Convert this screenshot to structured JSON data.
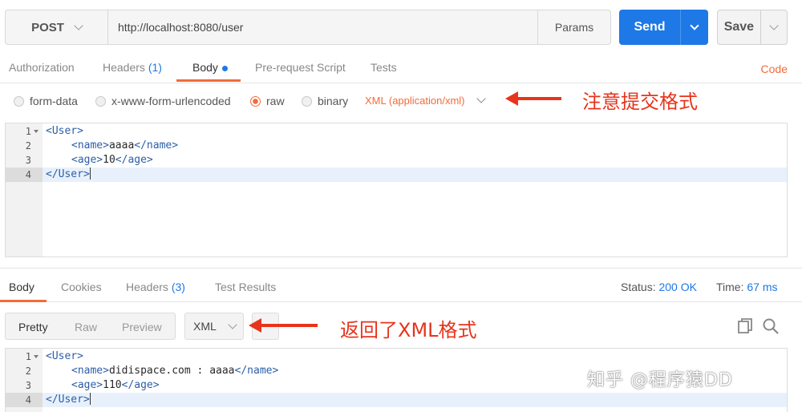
{
  "request": {
    "method": "POST",
    "url": "http://localhost:8080/user",
    "params_label": "Params",
    "send_label": "Send",
    "save_label": "Save"
  },
  "request_tabs": {
    "authorization": "Authorization",
    "headers": "Headers",
    "headers_count": "(1)",
    "body": "Body",
    "prerequest": "Pre-request Script",
    "tests": "Tests",
    "code": "Code"
  },
  "body_types": {
    "form_data": "form-data",
    "urlencoded": "x-www-form-urlencoded",
    "raw": "raw",
    "binary": "binary",
    "selected": "raw",
    "content_type": "XML (application/xml)"
  },
  "request_editor": {
    "line_numbers": [
      "1",
      "2",
      "3",
      "4"
    ],
    "line1_tag": "<User>",
    "line2_open": "<name>",
    "line2_text": "aaaa",
    "line2_close": "</name>",
    "line3_open": "<age>",
    "line3_text": "10",
    "line3_close": "</age>",
    "line4_tag": "</User>"
  },
  "annotations": {
    "note_request": "注意提交格式",
    "note_response": "返回了XML格式"
  },
  "response_tabs": {
    "body": "Body",
    "cookies": "Cookies",
    "headers": "Headers",
    "headers_count": "(3)",
    "test_results": "Test Results"
  },
  "response_status": {
    "status_label": "Status:",
    "status_value": "200 OK",
    "time_label": "Time:",
    "time_value": "67 ms"
  },
  "response_view": {
    "pretty": "Pretty",
    "raw": "Raw",
    "preview": "Preview",
    "format": "XML"
  },
  "response_editor": {
    "line_numbers": [
      "1",
      "2",
      "3",
      "4"
    ],
    "line1_tag": "<User>",
    "line2_open": "<name>",
    "line2_text": "didispace.com : aaaa",
    "line2_close": "</name>",
    "line3_open": "<age>",
    "line3_text": "110",
    "line3_close": "</age>",
    "line4_tag": "</User>"
  },
  "watermark": "知乎 @程序猿DD",
  "colors": {
    "accent_orange": "#f26b3a",
    "send_blue": "#1e78e6",
    "annotation_red": "#e8341c"
  }
}
